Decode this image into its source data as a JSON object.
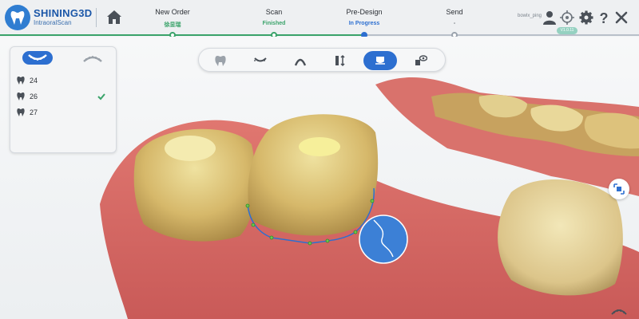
{
  "app": {
    "brand": "SHINING3D",
    "product": "IntraoralScan"
  },
  "steps": [
    {
      "title": "New Order",
      "status": "徐显瑞",
      "status_color": "#3aa36a"
    },
    {
      "title": "Scan",
      "status": "Finished",
      "status_color": "#3aa36a"
    },
    {
      "title": "Pre-Design",
      "status": "In Progress",
      "status_color": "#2d6fd0"
    },
    {
      "title": "Send",
      "status": "-",
      "status_color": "#6b727a"
    }
  ],
  "header": {
    "user_name": "bowlx_ping",
    "badge": "V1.0.11"
  },
  "icons": {
    "home": "home-icon",
    "user": "user-icon",
    "target": "crosshair-icon",
    "settings": "gear-icon",
    "help": "question-icon",
    "close": "close-icon"
  },
  "jaw_selector": {
    "upper": "upper-jaw-icon",
    "lower": "lower-jaw-icon",
    "selected": "upper"
  },
  "teeth": [
    {
      "number": "24",
      "checked": false
    },
    {
      "number": "26",
      "checked": true
    },
    {
      "number": "27",
      "checked": false
    }
  ],
  "toolbar": {
    "tools": [
      "tooth-icon",
      "cut-icon",
      "arch-icon",
      "align-icon",
      "margin-icon",
      "visibility-icon"
    ],
    "active_tool_index": 4
  },
  "colors": {
    "accent": "#2d6fd0",
    "success": "#3aa36a",
    "brand": "#1b57a8"
  }
}
